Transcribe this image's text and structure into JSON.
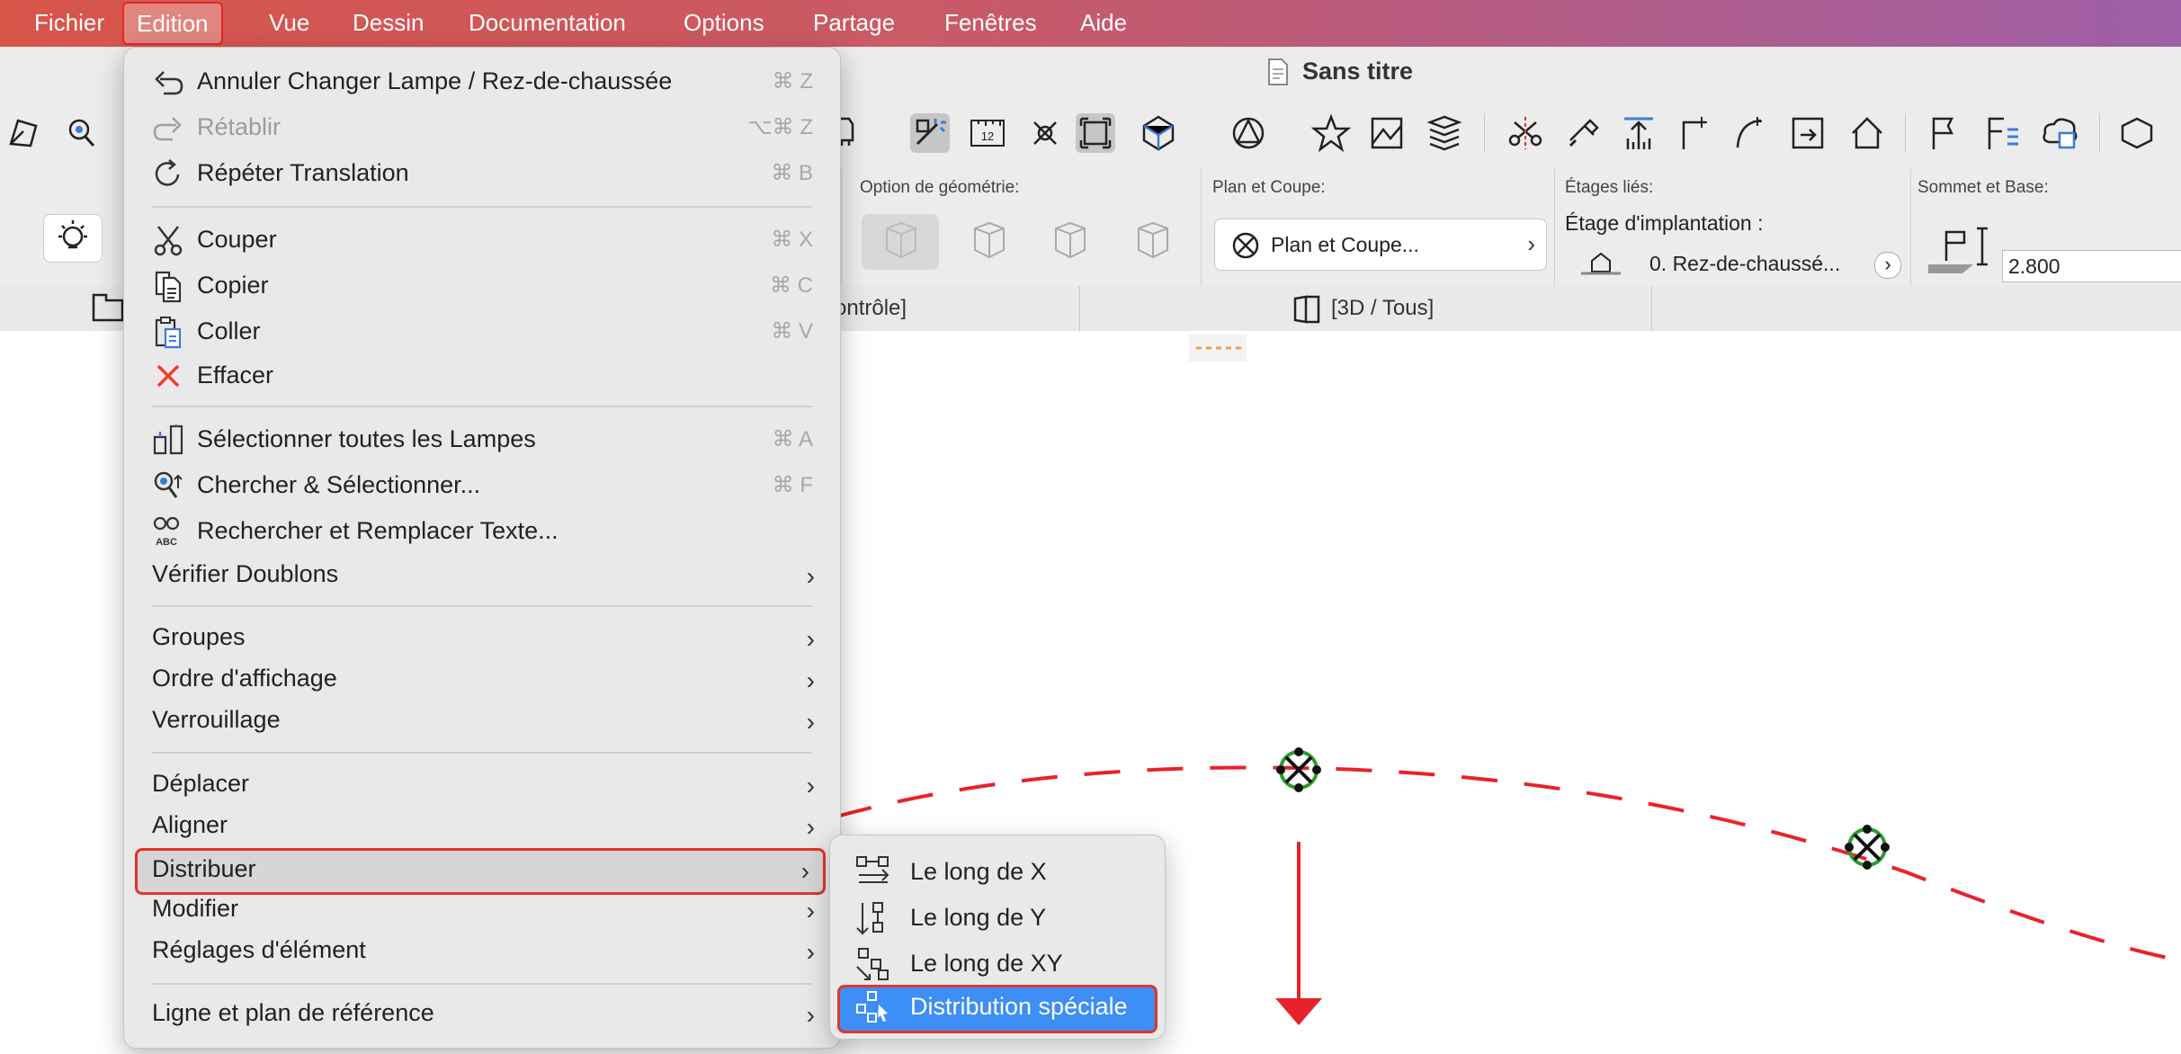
{
  "menubar": {
    "items": [
      "Fichier",
      "Edition",
      "Vue",
      "Dessin",
      "Documentation",
      "Options",
      "Partage",
      "Fenêtres",
      "Aide"
    ],
    "active": "Edition"
  },
  "window": {
    "title": "Sans titre"
  },
  "infobox": {
    "geometry_label": "Option de géométrie:",
    "plan_section_label": "Plan et Coupe:",
    "plan_section_button": "Plan et Coupe...",
    "stories_label": "Étages liés:",
    "home_story_label": "Étage d'implantation :",
    "home_story_value": "0. Rez-de-chaussé...",
    "top_base_label": "Sommet et Base:",
    "height_value": "2.800"
  },
  "tabs": {
    "left_fragment": "ontrôle]",
    "view_3d": "[3D / Tous]"
  },
  "edit_menu": {
    "undo": {
      "label": "Annuler Changer Lampe / Rez-de-chaussée",
      "shortcut": "⌘ Z"
    },
    "redo": {
      "label": "Rétablir",
      "shortcut": "⌥⌘ Z",
      "disabled": true
    },
    "repeat": {
      "label": "Répéter Translation",
      "shortcut": "⌘ B"
    },
    "cut": {
      "label": "Couper",
      "shortcut": "⌘ X"
    },
    "copy": {
      "label": "Copier",
      "shortcut": "⌘ C"
    },
    "paste": {
      "label": "Coller",
      "shortcut": "⌘ V"
    },
    "delete": {
      "label": "Effacer"
    },
    "select_all": {
      "label": "Sélectionner toutes les Lampes",
      "shortcut": "⌘ A"
    },
    "find_select": {
      "label": "Chercher & Sélectionner...",
      "shortcut": "⌘ F"
    },
    "find_replace": {
      "label": "Rechercher et Remplacer Texte..."
    },
    "check_duplicates": {
      "label": "Vérifier Doublons"
    },
    "groups": {
      "label": "Groupes"
    },
    "display_order": {
      "label": "Ordre d'affichage"
    },
    "locking": {
      "label": "Verrouillage"
    },
    "move": {
      "label": "Déplacer"
    },
    "align": {
      "label": "Aligner"
    },
    "distribute": {
      "label": "Distribuer"
    },
    "reshape": {
      "label": "Modifier"
    },
    "element_settings": {
      "label": "Réglages d'élément"
    },
    "reference_line": {
      "label": "Ligne et plan de référence"
    }
  },
  "distribute_submenu": {
    "along_x": "Le long de X",
    "along_y": "Le long de Y",
    "along_xy": "Le long de  XY",
    "special": "Distribution spéciale"
  },
  "colors": {
    "menubar_start": "#d8554a",
    "menubar_end": "#9e5fa6",
    "highlight_blue": "#3d8ef5",
    "outline_red": "#e0352b",
    "dashed_arc": "#e8222a"
  },
  "icons": [
    "undo-icon",
    "redo-icon",
    "repeat-icon",
    "scissors-icon",
    "copy-icon",
    "paste-icon",
    "delete-x-icon",
    "select-lamps-icon",
    "find-select-icon",
    "find-replace-icon",
    "distribute-x-icon",
    "distribute-y-icon",
    "distribute-xy-icon",
    "distribute-special-icon"
  ]
}
